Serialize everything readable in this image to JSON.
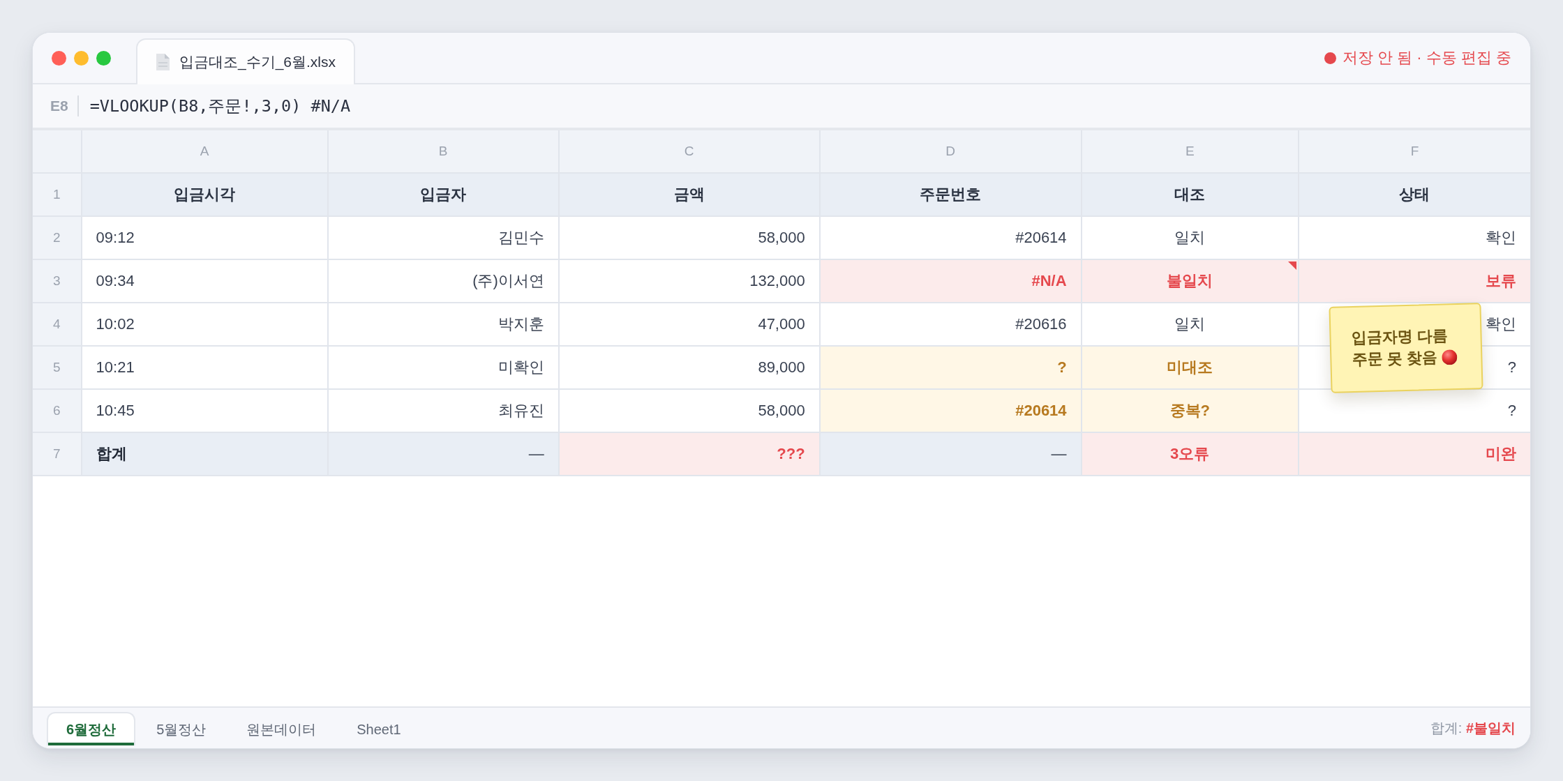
{
  "window": {
    "tab": {
      "title": "입금대조_수기_6월.xlsx"
    },
    "status": {
      "modified": true,
      "text": "저장 안 됨 · 수동 편집 중"
    }
  },
  "formula_bar": {
    "cell_ref": "E8",
    "formula": "=VLOOKUP(B8,주문!,3,0) #N/A"
  },
  "sheet": {
    "columns": [
      "A",
      "B",
      "C",
      "D",
      "E",
      "F"
    ],
    "rows": [
      {
        "number": "1",
        "kind": "header",
        "cells": [
          {
            "text": "입금시각",
            "kind": "plain",
            "comment": false
          },
          {
            "text": "입금자",
            "kind": "plain",
            "comment": false
          },
          {
            "text": "금액",
            "kind": "plain",
            "comment": false
          },
          {
            "text": "주문번호",
            "kind": "plain",
            "comment": false
          },
          {
            "text": "대조",
            "kind": "plain",
            "comment": false
          },
          {
            "text": "상태",
            "kind": "plain",
            "comment": false
          }
        ]
      },
      {
        "number": "2",
        "kind": "data",
        "cells": [
          {
            "text": "09:12",
            "kind": "plain",
            "comment": false
          },
          {
            "text": "김민수",
            "kind": "plain",
            "comment": false
          },
          {
            "text": "58,000",
            "kind": "plain",
            "comment": false
          },
          {
            "text": "#20614",
            "kind": "plain",
            "comment": false
          },
          {
            "text": "일치",
            "kind": "plain",
            "comment": false
          },
          {
            "text": "확인",
            "kind": "plain",
            "comment": false
          }
        ]
      },
      {
        "number": "3",
        "kind": "data",
        "cells": [
          {
            "text": "09:34",
            "kind": "plain",
            "comment": false
          },
          {
            "text": "(주)이서연",
            "kind": "plain",
            "comment": false
          },
          {
            "text": "132,000",
            "kind": "plain",
            "comment": false
          },
          {
            "text": "#N/A",
            "kind": "error",
            "comment": false
          },
          {
            "text": "불일치",
            "kind": "error",
            "comment": true
          },
          {
            "text": "보류",
            "kind": "error",
            "comment": false
          }
        ]
      },
      {
        "number": "4",
        "kind": "data",
        "cells": [
          {
            "text": "10:02",
            "kind": "plain",
            "comment": false
          },
          {
            "text": "박지훈",
            "kind": "plain",
            "comment": false
          },
          {
            "text": "47,000",
            "kind": "plain",
            "comment": false
          },
          {
            "text": "#20616",
            "kind": "plain",
            "comment": false
          },
          {
            "text": "일치",
            "kind": "plain",
            "comment": false
          },
          {
            "text": "확인",
            "kind": "plain",
            "comment": false
          }
        ]
      },
      {
        "number": "5",
        "kind": "data",
        "cells": [
          {
            "text": "10:21",
            "kind": "plain",
            "comment": false
          },
          {
            "text": "미확인",
            "kind": "plain",
            "comment": false
          },
          {
            "text": "89,000",
            "kind": "plain",
            "comment": false
          },
          {
            "text": "?",
            "kind": "warning",
            "comment": false
          },
          {
            "text": "미대조",
            "kind": "warning",
            "comment": false
          },
          {
            "text": "?",
            "kind": "plain",
            "comment": false
          }
        ]
      },
      {
        "number": "6",
        "kind": "data",
        "cells": [
          {
            "text": "10:45",
            "kind": "plain",
            "comment": false
          },
          {
            "text": "최유진",
            "kind": "plain",
            "comment": false
          },
          {
            "text": "58,000",
            "kind": "plain",
            "comment": false
          },
          {
            "text": "#20614",
            "kind": "warning",
            "comment": false
          },
          {
            "text": "중복?",
            "kind": "warning",
            "comment": false
          },
          {
            "text": "?",
            "kind": "plain",
            "comment": false
          }
        ]
      },
      {
        "number": "7",
        "kind": "total",
        "cells": [
          {
            "text": "합계",
            "kind": "plain",
            "comment": false
          },
          {
            "text": "—",
            "kind": "plain",
            "comment": false
          },
          {
            "text": "???",
            "kind": "error",
            "comment": false
          },
          {
            "text": "—",
            "kind": "plain",
            "comment": false
          },
          {
            "text": "3오류",
            "kind": "error",
            "comment": false
          },
          {
            "text": "미완",
            "kind": "error",
            "comment": false
          }
        ]
      }
    ]
  },
  "note": {
    "lines": [
      "입금자명 다름",
      "주문 못 찾음"
    ]
  },
  "sheet_tabs": [
    {
      "label": "6월정산",
      "selected": true
    },
    {
      "label": "5월정산",
      "selected": false
    },
    {
      "label": "원본데이터",
      "selected": false
    },
    {
      "label": "Sheet1",
      "selected": false
    }
  ],
  "status_bar": {
    "summary": "합계: **#불일치**"
  }
}
